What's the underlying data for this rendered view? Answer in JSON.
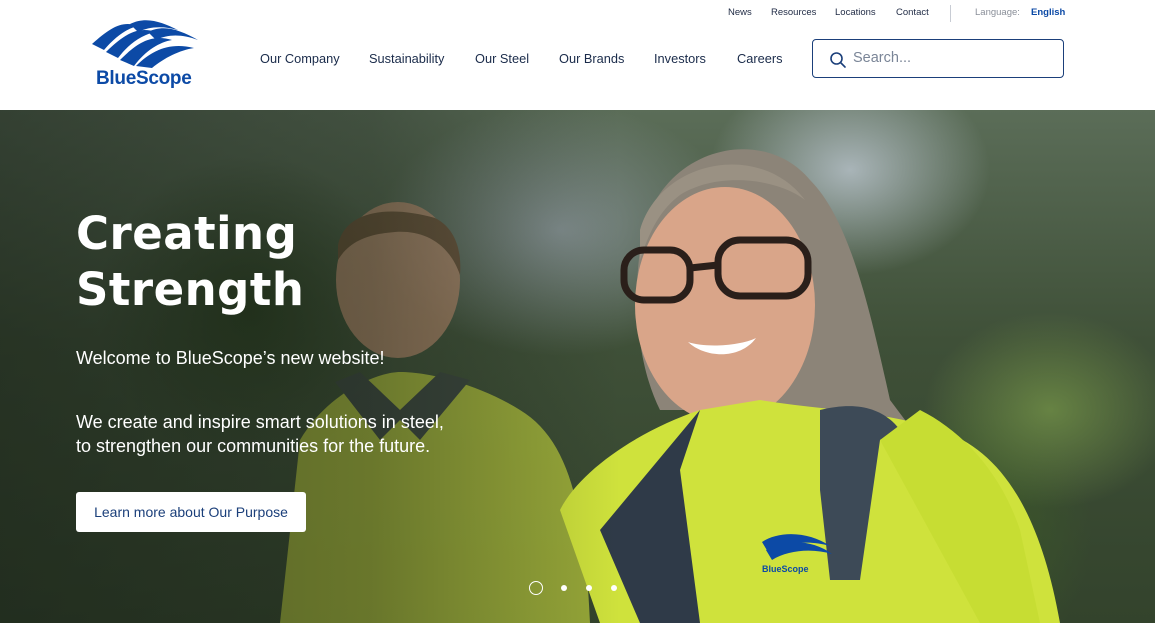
{
  "brand": {
    "name": "BlueScope",
    "color": "#0c4aa6"
  },
  "utility_nav": {
    "links": [
      "News",
      "Resources",
      "Locations",
      "Contact"
    ],
    "language_label": "Language:",
    "language_value": "English"
  },
  "main_nav": {
    "items": [
      "Our Company",
      "Sustainability",
      "Our Steel",
      "Our Brands",
      "Investors",
      "Careers"
    ]
  },
  "search": {
    "placeholder": "Search...",
    "value": "",
    "icon": "search-icon"
  },
  "hero": {
    "title_line1": "Creating",
    "title_line2": "Strength",
    "welcome": "Welcome to BlueScope’s new website!",
    "tagline_line1": "We create and inspire smart solutions in steel,",
    "tagline_line2": "to strengthen our communities for the future.",
    "cta_label": "Learn more about Our Purpose",
    "vest_logo_text": "BlueScope"
  },
  "carousel": {
    "slide_count": 4,
    "active_index": 1
  }
}
